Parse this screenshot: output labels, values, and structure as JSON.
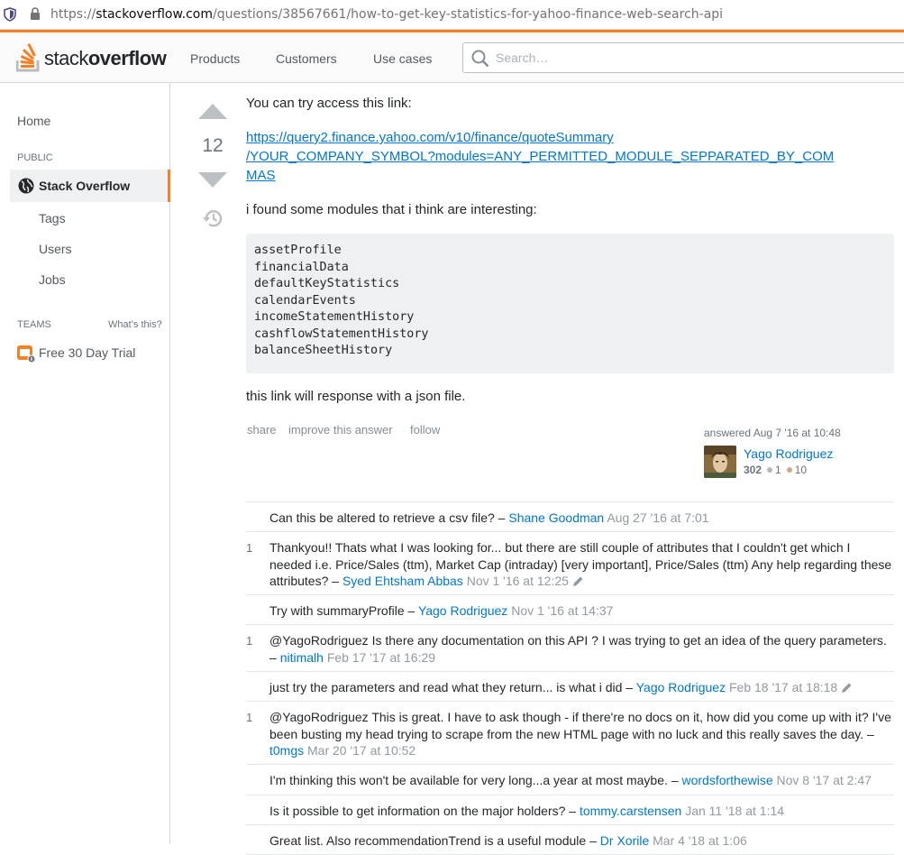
{
  "browser": {
    "url_scheme": "https://",
    "url_host": "stackoverflow.com",
    "url_path": "/questions/38567661/how-to-get-key-statistics-for-yahoo-finance-web-search-api"
  },
  "header": {
    "logo_light": "stack",
    "logo_bold": "overflow",
    "nav": [
      "Products",
      "Customers",
      "Use cases"
    ],
    "search_placeholder": "Search…"
  },
  "sidebar": {
    "home": "Home",
    "public_label": "PUBLIC",
    "stack_overflow": "Stack Overflow",
    "sub_items": [
      "Tags",
      "Users",
      "Jobs"
    ],
    "teams_label": "TEAMS",
    "whats_this": "What’s this?",
    "free_trial": "Free 30 Day Trial"
  },
  "post": {
    "score": "12",
    "intro": "You can try access this link:",
    "link_line1": "https://query2.finance.yahoo.com/v10/finance/quoteSummary",
    "link_line2": "/YOUR_COMPANY_SYMBOL?modules=ANY_PERMITTED_MODULE_SEPPARATED_BY_COM",
    "link_line3": "MAS",
    "modules_intro": "i found some modules that i think are interesting:",
    "code_lines": [
      "assetProfile",
      "financialData",
      "defaultKeyStatistics",
      "calendarEvents",
      "incomeStatementHistory",
      "cashflowStatementHistory",
      "balanceSheetHistory"
    ],
    "outro": "this link will response with a json file.",
    "menu": [
      "share",
      "improve this answer",
      "follow"
    ],
    "answered": "answered Aug 7 '16 at 10:48",
    "author": "Yago Rodriguez",
    "reputation": "302",
    "silver_badges": "1",
    "bronze_badges": "10",
    "colors": {
      "silver": "#b4b8bc",
      "bronze": "#d1a684",
      "accent": "#f48024",
      "link": "#0077cc"
    }
  },
  "comments": [
    {
      "score": "",
      "text": "Can this be altered to retrieve a csv file? – ",
      "user": "Shane Goodman",
      "date": "Aug 27 '16 at 7:01",
      "edited": false
    },
    {
      "score": "1",
      "text": "Thankyou!! Thats what I was looking for... but there are still couple of attributes that I couldn't get which I needed i.e. Price/Sales (ttm), Market Cap (intraday) [very important], Price/Sales (ttm) Any help regarding these attributes? – ",
      "user": "Syed Ehtsham Abbas",
      "date": "Nov 1 '16 at 12:25",
      "edited": true
    },
    {
      "score": "",
      "text": "Try with summaryProfile – ",
      "user": "Yago Rodriguez",
      "date": "Nov 1 '16 at 14:37",
      "edited": false
    },
    {
      "score": "1",
      "text": "@YagoRodriguez Is there any documentation on this API ? I was trying to get an idea of the query parameters. – ",
      "user": "nitimalh",
      "date": "Feb 17 '17 at 16:29",
      "edited": false
    },
    {
      "score": "",
      "text": "just try the parameters and read what they return... is what i did – ",
      "user": "Yago Rodriguez",
      "date": "Feb 18 '17 at 18:18",
      "edited": true
    },
    {
      "score": "1",
      "text": "@YagoRodriguez This is great. I have to ask though - if there're no docs on it, how did you come up with it? I've been busting my head trying to scrape from the new HTML page with no luck and this really saves the day. – ",
      "user": "t0mgs",
      "date": "Mar 20 '17 at 10:52",
      "edited": false
    },
    {
      "score": "",
      "text": "I'm thinking this won't be available for very long...a year at most maybe. – ",
      "user": "wordsforthewise",
      "date": "Nov 8 '17 at 2:47",
      "edited": false
    },
    {
      "score": "",
      "text": "Is it possible to get information on the major holders? – ",
      "user": "tommy.carstensen",
      "date": "Jan 11 '18 at 1:14",
      "edited": false
    },
    {
      "score": "",
      "text": "Great list. Also recommendationTrend is a useful module – ",
      "user": "Dr Xorile",
      "date": "Mar 4 '18 at 1:06",
      "edited": false
    }
  ]
}
